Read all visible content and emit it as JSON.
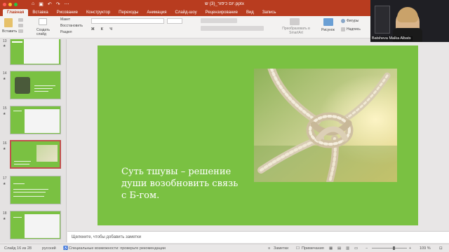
{
  "window": {
    "title": "יום כיפור_(3) ש.pptx"
  },
  "tabs": [
    "Главная",
    "Вставка",
    "Рисование",
    "Конструктор",
    "Переходы",
    "Анимация",
    "Слайд-шоу",
    "Рецензирование",
    "Вид",
    "Запись"
  ],
  "ribbon": {
    "paste": "Вставить",
    "new_slide": "Создать слайд",
    "layout": "Макет",
    "reset": "Восстановить",
    "section": "Раздел",
    "convert_smartart": "Преобразовать в SmartArt",
    "picture": "Рисунок",
    "shapes": "Фигуры",
    "textbox": "Надпись"
  },
  "slides": [
    {
      "number": "13"
    },
    {
      "number": "14"
    },
    {
      "number": "15"
    },
    {
      "number": "16"
    },
    {
      "number": "17"
    },
    {
      "number": "18"
    }
  ],
  "slide": {
    "text": "Суть тшувы – решение души возобновить связь с Б-гом."
  },
  "notes": {
    "placeholder": "Щелкните, чтобы добавить заметки"
  },
  "status": {
    "slide_of": "Слайд 16 из 28",
    "language": "русский",
    "accessibility": "Специальные возможности: проверьте рекомендации",
    "notes_btn": "Заметки",
    "comments_btn": "Примечания",
    "zoom": "109 %"
  },
  "video": {
    "name": "Batsheva Malka Albats"
  },
  "colors": {
    "accent": "#b83c1f",
    "slide_bg": "#7ac142"
  }
}
